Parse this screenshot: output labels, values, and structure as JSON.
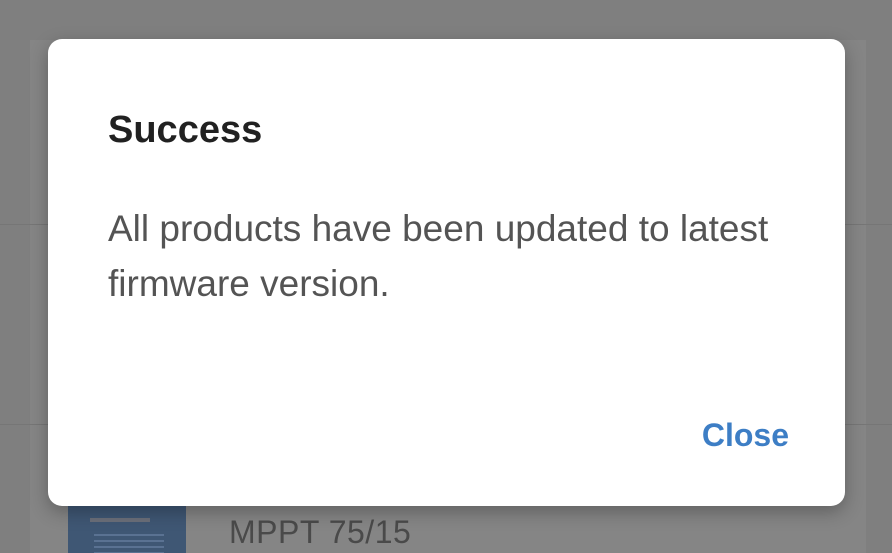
{
  "background": {
    "product_name": "MPPT 75/15"
  },
  "dialog": {
    "title": "Success",
    "message": "All products have been updated to latest firmware version.",
    "close_label": "Close"
  },
  "colors": {
    "accent": "#3d7ec5",
    "scrim": "#7f7f7f",
    "title_text": "#212121",
    "body_text": "#545454"
  }
}
